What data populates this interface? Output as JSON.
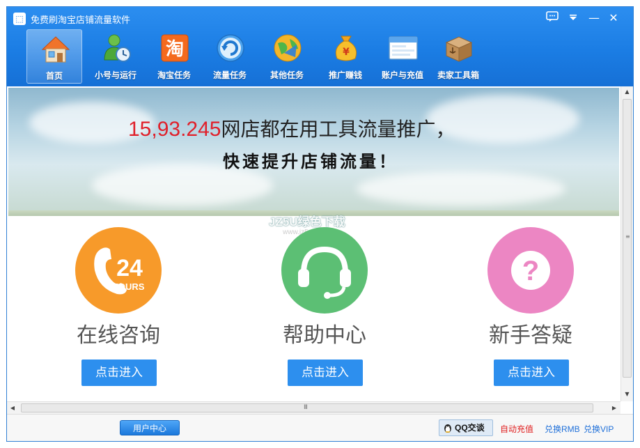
{
  "window": {
    "title": "免费刷淘宝店铺流量软件"
  },
  "titlebar": {
    "chat_icon": "chat-bubble-icon",
    "dropdown_icon": "dropdown-arrow-icon",
    "minimize_glyph": "—",
    "close_glyph": "✕"
  },
  "toolbar": {
    "items": [
      {
        "label": "首页",
        "icon": "home-icon",
        "active": true
      },
      {
        "label": "小号与运行",
        "icon": "user-clock-icon"
      },
      {
        "label": "淘宝任务",
        "icon": "taobao-icon"
      },
      {
        "label": "流量任务",
        "icon": "refresh-icon"
      },
      {
        "label": "其他任务",
        "icon": "globe-icon"
      },
      {
        "label": "推广赚钱",
        "icon": "money-bag-icon"
      },
      {
        "label": "账户与充值",
        "icon": "window-icon"
      },
      {
        "label": "卖家工具箱",
        "icon": "box-icon"
      }
    ],
    "taobao_glyph": "淘"
  },
  "banner": {
    "count": "15,93.245",
    "line1_rest": "网店都在用工具流量推广，",
    "line2": "快速提升店铺流量！",
    "watermark": "JZ5U绿色下载",
    "watermark_sub": "www.jz5u.com"
  },
  "services": [
    {
      "title": "在线咨询",
      "button": "点击进入",
      "icon": "24-hours-phone-icon",
      "color": "#f79a2a",
      "icon_text": "24",
      "icon_subtext": "HOURS"
    },
    {
      "title": "帮助中心",
      "button": "点击进入",
      "icon": "headset-icon",
      "color": "#5cbf74"
    },
    {
      "title": "新手答疑",
      "button": "点击进入",
      "icon": "question-mark-icon",
      "color": "#ec86c3",
      "icon_text": "?"
    }
  ],
  "scrollbars": {
    "up": "▲",
    "down": "▼",
    "left": "◀",
    "right": "▶",
    "v_grip": "≡",
    "h_grip": "III"
  },
  "statusbar": {
    "user_center": "用户中心",
    "qq_chat": "QQ交谈",
    "auto_recharge": "自动充值",
    "exchange_rmb": "兑换RMB",
    "exchange_vip": "兑换VIP",
    "colors": {
      "auto_recharge": "#e02020",
      "exchange": "#1e6fd9"
    }
  }
}
